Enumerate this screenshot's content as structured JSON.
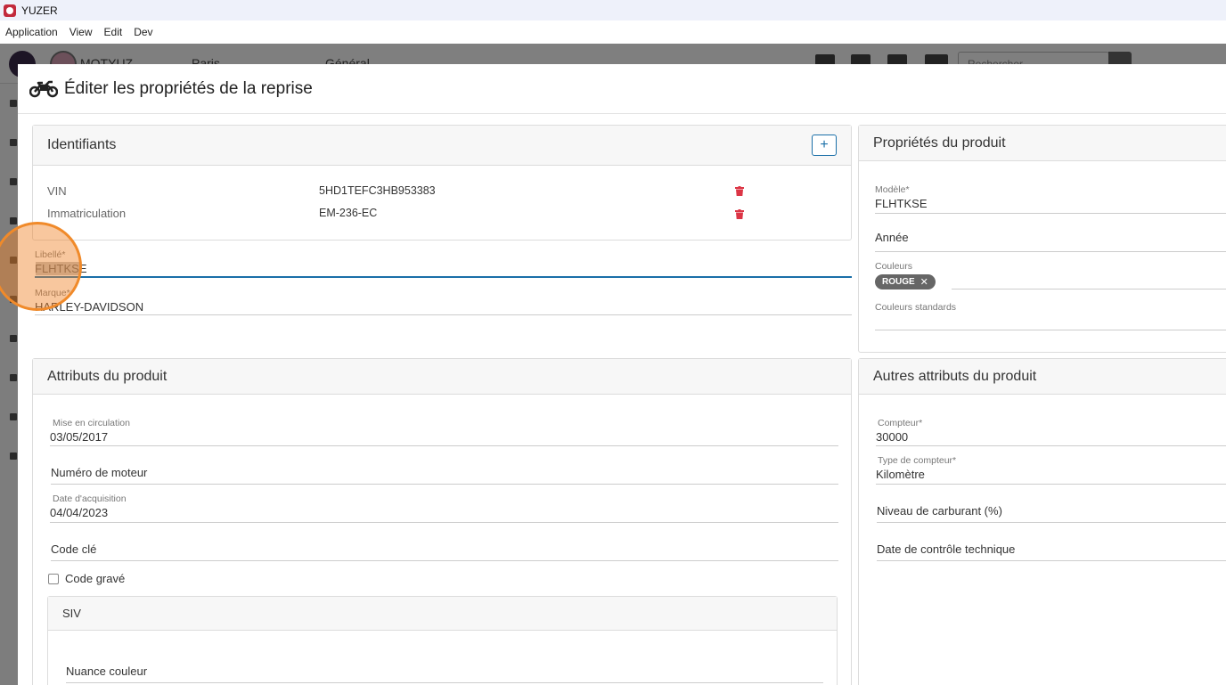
{
  "window": {
    "title": "YUZER"
  },
  "menu": [
    "Application",
    "View",
    "Edit",
    "Dev"
  ],
  "background": {
    "username": "MOTYUZ",
    "city": "Paris",
    "section": "Général",
    "search_placeholder": "Rechercher"
  },
  "modal": {
    "title": "Éditer les propriétés de la reprise",
    "identifiants": {
      "title": "Identifiants",
      "add_label": "+",
      "rows": [
        {
          "label": "VIN",
          "value": "5HD1TEFC3HB953383"
        },
        {
          "label": "Immatriculation",
          "value": "EM-236-EC"
        }
      ]
    },
    "libelle": {
      "label": "Libellé*",
      "value": "FLHTKSE"
    },
    "marque": {
      "label": "Marque*",
      "value": "HARLEY-DAVIDSON"
    },
    "proprietes": {
      "title": "Propriétés du produit",
      "modele": {
        "label": "Modèle*",
        "value": "FLHTKSE"
      },
      "annee": {
        "label": "Année"
      },
      "couleurs": {
        "label": "Couleurs",
        "chip": "ROUGE",
        "chip_remove": "✕"
      },
      "couleurs_standards": {
        "label": "Couleurs standards"
      }
    },
    "attributs": {
      "title": "Attributs du produit",
      "mise_en_circulation": {
        "label": "Mise en circulation",
        "value": "03/05/2017"
      },
      "numero_moteur": {
        "label": "Numéro de moteur"
      },
      "date_acquisition": {
        "label": "Date d'acquisition",
        "value": "04/04/2023"
      },
      "code_cle": {
        "label": "Code clé"
      },
      "code_grave": {
        "label": "Code gravé",
        "checked": false
      },
      "siv": {
        "title": "SIV",
        "nuance_couleur": {
          "label": "Nuance couleur"
        }
      }
    },
    "autres": {
      "title": "Autres attributs du produit",
      "compteur": {
        "label": "Compteur*",
        "value": "30000"
      },
      "type_compteur": {
        "label": "Type de compteur*",
        "value": "Kilomètre"
      },
      "niveau_carburant": {
        "label": "Niveau de carburant (%)"
      },
      "date_controle": {
        "label": "Date de contrôle technique"
      }
    }
  },
  "colors": {
    "accent": "#1a6fa8",
    "danger": "#dc3545",
    "chip": "#666666"
  }
}
